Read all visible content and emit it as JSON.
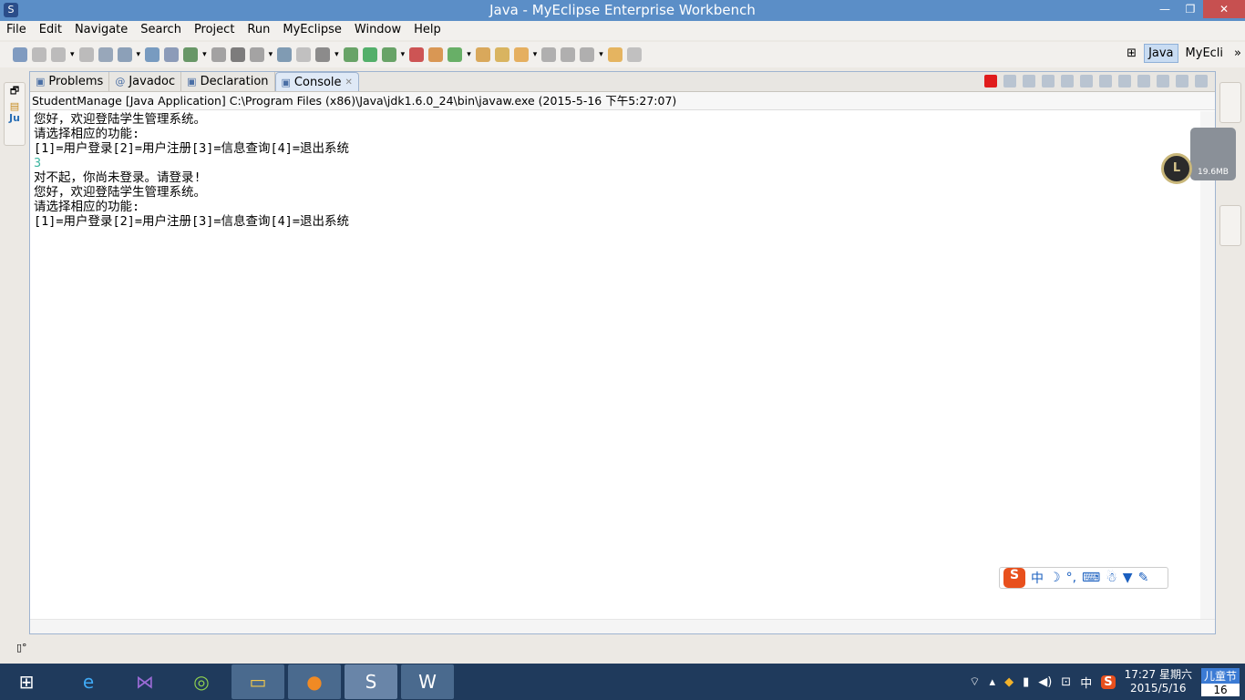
{
  "window": {
    "title": "Java - MyEclipse Enterprise Workbench"
  },
  "menu": [
    "File",
    "Edit",
    "Navigate",
    "Search",
    "Project",
    "Run",
    "MyEclipse",
    "Window",
    "Help"
  ],
  "perspectives": {
    "java": "Java",
    "myeclipse": "MyEcli"
  },
  "tabs": [
    {
      "label": "Problems",
      "icon": "problems-icon"
    },
    {
      "label": "Javadoc",
      "icon": "@"
    },
    {
      "label": "Declaration",
      "icon": "declaration-icon"
    },
    {
      "label": "Console",
      "icon": "console-icon",
      "active": true
    }
  ],
  "console": {
    "header": "StudentManage [Java Application] C:\\Program Files (x86)\\Java\\jdk1.6.0_24\\bin\\javaw.exe (2015-5-16 下午5:27:07)",
    "lines": [
      {
        "text": "您好，欢迎登陆学生管理系统。",
        "input": false
      },
      {
        "text": "请选择相应的功能:",
        "input": false
      },
      {
        "text": "[1]=用户登录[2]=用户注册[3]=信息查询[4]=退出系统",
        "input": false
      },
      {
        "text": "3",
        "input": true
      },
      {
        "text": "对不起，你尚未登录。请登录!",
        "input": false
      },
      {
        "text": "您好，欢迎登陆学生管理系统。",
        "input": false
      },
      {
        "text": "请选择相应的功能:",
        "input": false
      },
      {
        "text": "[1]=用户登录[2]=用户注册[3]=信息查询[4]=退出系统",
        "input": false
      }
    ]
  },
  "memory_widget": {
    "value": "19.6MB",
    "logo": "L"
  },
  "ime": {
    "logo": "S",
    "mode": "中",
    "items": [
      "中",
      "☽",
      "°,",
      "⌨",
      "☃",
      "👕",
      "🔧"
    ]
  },
  "taskbar": {
    "apps": [
      "windows-start",
      "internet-explorer",
      "visual-studio",
      "app-ring",
      "file-explorer",
      "app-orange",
      "myeclipse",
      "word"
    ]
  },
  "tray": {
    "ime": "中",
    "time": "17:27 星期六",
    "date": "2015/5/16",
    "calendar_title": "儿童节",
    "calendar_day": "16"
  }
}
